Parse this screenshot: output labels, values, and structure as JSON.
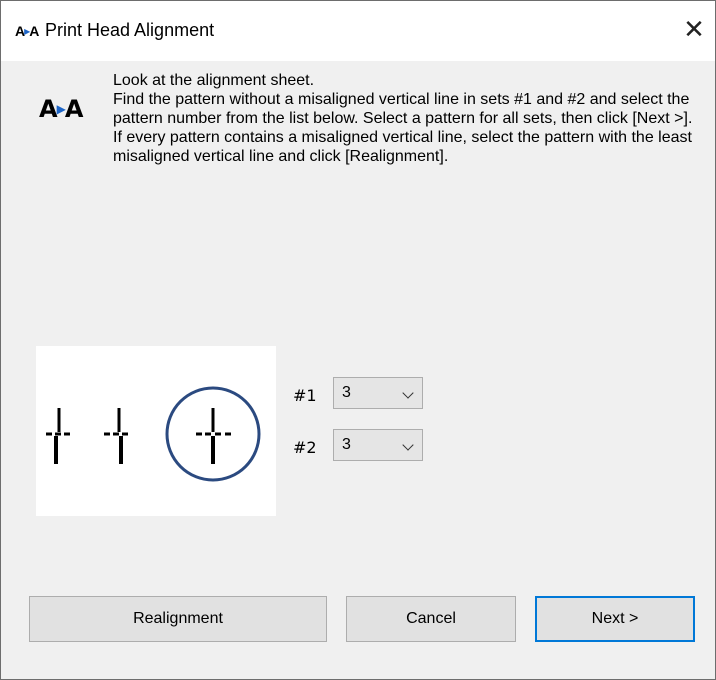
{
  "window": {
    "title": "Print Head Alignment"
  },
  "instructions": [
    "Look at the alignment sheet.",
    "Find the pattern without a misaligned vertical line in sets #1 and #2 and select the pattern number from the list below. Select a pattern for all sets, then click [Next >].",
    "If every pattern contains a misaligned vertical line, select the pattern with the least misaligned vertical line and click [Realignment]."
  ],
  "sets": [
    {
      "label": "#1",
      "value": "3"
    },
    {
      "label": "#2",
      "value": "3"
    }
  ],
  "buttons": {
    "realignment": "Realignment",
    "cancel": "Cancel",
    "next": "Next >"
  },
  "icons": {
    "app_icon": "A▸A",
    "close": "close-icon",
    "dropdown": "chevron-down-icon"
  },
  "colors": {
    "accent": "#0078d7",
    "circle": "#2b4a80",
    "logo_arrow": "#1e66c8"
  }
}
